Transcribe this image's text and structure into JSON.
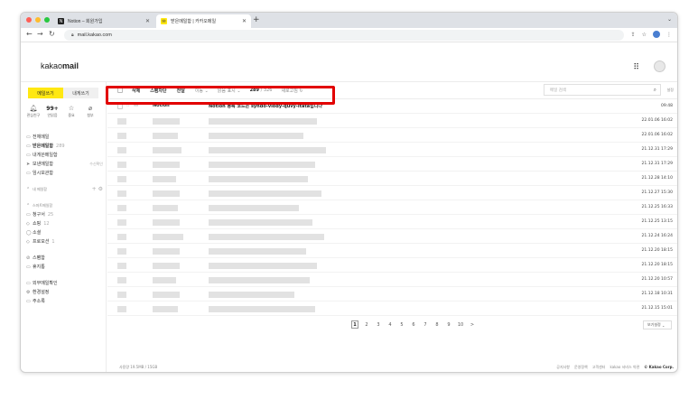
{
  "browser": {
    "tabs": [
      {
        "title": "Notion – 회원가입",
        "active": false,
        "favicon": "notion-icon"
      },
      {
        "title": "받은메일함 | 카카오메일",
        "active": true,
        "favicon": "kakao-icon"
      }
    ],
    "new_tab": "+",
    "url": "mail.kakao.com"
  },
  "app": {
    "logo_text": "kakao",
    "logo_bold": "mail"
  },
  "sidebar": {
    "compose_label": "메일쓰기",
    "self_label": "내게쓰기",
    "quick": [
      {
        "count": "",
        "label": "관심친구",
        "icon": "bell-icon"
      },
      {
        "count": "99+",
        "label": "안읽음",
        "icon": "unread-icon"
      },
      {
        "count": "",
        "label": "중요",
        "icon": "star-icon"
      },
      {
        "count": "",
        "label": "첨부",
        "icon": "paperclip-icon"
      }
    ],
    "items": [
      {
        "label": "전체메일",
        "count": "",
        "side": ""
      },
      {
        "label": "받은메일함",
        "count": "289",
        "side": ""
      },
      {
        "label": "내게쓴메일함",
        "count": "",
        "side": ""
      },
      {
        "label": "보낸메일함",
        "count": "",
        "side": "수신확인"
      },
      {
        "label": "임시보관함",
        "count": "",
        "side": ""
      }
    ],
    "my_folders": "내 메일함",
    "smart_folders": "스마트메일함",
    "smart_items": [
      {
        "label": "청구서",
        "count": "25"
      },
      {
        "label": "쇼핑",
        "count": "12"
      },
      {
        "label": "소셜",
        "count": ""
      },
      {
        "label": "프로모션",
        "count": "1"
      }
    ],
    "extra_items": [
      {
        "label": "스팸함"
      },
      {
        "label": "휴지통"
      }
    ],
    "bottom_items": [
      {
        "label": "외부메일확인"
      },
      {
        "label": "환경설정"
      },
      {
        "label": "주소록"
      }
    ]
  },
  "toolbar": {
    "delete": "삭제",
    "spam": "스팸차단",
    "reply": "전달",
    "move": "이동",
    "read_mark": "읽음 표시",
    "count": "289",
    "total": "326",
    "refresh": "새로고침",
    "search_placeholder": "메일 검색",
    "settings": "설정"
  },
  "emails": [
    {
      "sender": "Notion",
      "subject": "Notion 등록 코드는 syndo-vlody-quvy-itata입니다",
      "date": "09:48"
    },
    {
      "date": "22.01.06 16:02"
    },
    {
      "date": "22.01.06 16:02"
    },
    {
      "date": "21.12.31 17:29"
    },
    {
      "date": "21.12.31 17:29"
    },
    {
      "date": "21.12.28 14:10"
    },
    {
      "date": "21.12.27 15:30"
    },
    {
      "date": "21.12.25 16:33"
    },
    {
      "date": "21.12.25 13:15"
    },
    {
      "date": "21.12.24 16:24"
    },
    {
      "date": "21.12.20 18:15"
    },
    {
      "date": "21.12.20 18:15"
    },
    {
      "date": "21.12.20 10:57"
    },
    {
      "date": "21.12.18 10:31"
    },
    {
      "date": "21.12.15 15:01"
    }
  ],
  "pager": {
    "pages": [
      "1",
      "2",
      "3",
      "4",
      "5",
      "6",
      "7",
      "8",
      "9",
      "10"
    ],
    "next": ">",
    "view_setting": "보기설정"
  },
  "footer": {
    "usage": "사용량 19.5MB / 15GB",
    "links": [
      "공지사항",
      "운영정책",
      "고객센터",
      "kakao 서비스 약관"
    ],
    "copyright": "© Kakao Corp."
  },
  "colors": {
    "accent": "#ffe812",
    "highlight": "#e20000"
  }
}
